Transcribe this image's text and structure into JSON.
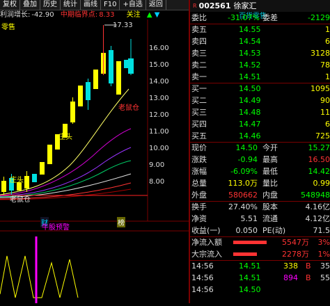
{
  "toolbar": {
    "buttons": [
      "复权",
      "叠加",
      "历史",
      "统计",
      "画线",
      "F10",
      "+自选",
      "返回"
    ]
  },
  "indicator_line": {
    "profit_label": "利润增长:",
    "profit_value": "-42.90",
    "mid_label": "中期临界点:",
    "mid_value": "8.33",
    "attention": "关注",
    "up_arrow": "▲",
    "down_arrow": "▼"
  },
  "left_tag": "零售",
  "price_axis": [
    "16.00",
    "15.00",
    "14.00",
    "13.00",
    "12.00",
    "11.00",
    "10.00",
    "9.00",
    "8.00"
  ],
  "annotations": {
    "high": "17.33",
    "shulao1": "老鼠仓",
    "shulao2": "老鼠仓",
    "zhuangtou1": "庄头",
    "zhuangtou2": "庄头",
    "cai": "财",
    "bang": "榜",
    "niugu": "牛股预警"
  },
  "colors": {
    "up": "#ff3333",
    "down": "#00e0e0",
    "yellow_candle": "#ffff00",
    "ma_white": "#e0e0e0",
    "ma_yellow": "#ffff00",
    "ma_magenta": "#cc00cc",
    "ma_green": "#00cc66"
  },
  "quote": {
    "r_mark": "R",
    "code": "002561",
    "name": "徐家汇",
    "sub": "百货零售",
    "weibi_label": "委比",
    "weibi_value": "-31.07%",
    "weicha_label": "委差",
    "weicha_value": "-2129",
    "asks": [
      {
        "label": "卖五",
        "price": "14.55",
        "vol": "1"
      },
      {
        "label": "卖四",
        "price": "14.54",
        "vol": "6"
      },
      {
        "label": "卖三",
        "price": "14.53",
        "vol": "3128"
      },
      {
        "label": "卖二",
        "price": "14.52",
        "vol": "78"
      },
      {
        "label": "卖一",
        "price": "14.51",
        "vol": "1"
      }
    ],
    "bids": [
      {
        "label": "买一",
        "price": "14.50",
        "vol": "1095"
      },
      {
        "label": "买二",
        "price": "14.49",
        "vol": "90"
      },
      {
        "label": "买三",
        "price": "14.48",
        "vol": "11"
      },
      {
        "label": "买四",
        "price": "14.47",
        "vol": "6"
      },
      {
        "label": "买五",
        "price": "14.46",
        "vol": "725"
      }
    ],
    "stats": [
      {
        "l1": "现价",
        "v1": "14.50",
        "c1": "green",
        "l2": "今开",
        "v2": "15.27",
        "c2": "green"
      },
      {
        "l1": "涨跌",
        "v1": "-0.94",
        "c1": "green",
        "l2": "最高",
        "v2": "16.50",
        "c2": "red"
      },
      {
        "l1": "涨幅",
        "v1": "-6.09%",
        "c1": "green",
        "l2": "最低",
        "v2": "14.42",
        "c2": "green"
      },
      {
        "l1": "总量",
        "v1": "113.0万",
        "c1": "yellow",
        "l2": "量比",
        "v2": "0.99",
        "c2": "yellow"
      },
      {
        "l1": "外盘",
        "v1": "580662",
        "c1": "red",
        "l2": "内盘",
        "v2": "548948",
        "c2": "green"
      }
    ],
    "stats2": [
      {
        "l1": "换手",
        "v1": "27.40%",
        "l2": "股本",
        "v2": "4.16亿"
      },
      {
        "l1": "净资",
        "v1": "5.51",
        "l2": "流通",
        "v2": "4.12亿"
      },
      {
        "l1": "收益(一)",
        "v1": "0.050",
        "l2": "PE(动)",
        "v2": "71.5"
      }
    ],
    "flows": [
      {
        "label": "净流入额",
        "value": "5547万",
        "pct": "3%"
      },
      {
        "label": "大宗流入",
        "value": "2278万",
        "pct": "1%"
      }
    ],
    "ticks": [
      {
        "time": "14:56",
        "price": "14.51",
        "vol": "338",
        "side": "B",
        "num": "35"
      },
      {
        "time": "14:56",
        "price": "14.51",
        "vol": "894",
        "side": "B",
        "num": "55"
      },
      {
        "time": "14:56",
        "price": "14.50",
        "vol": "",
        "side": "",
        "num": ""
      }
    ]
  }
}
